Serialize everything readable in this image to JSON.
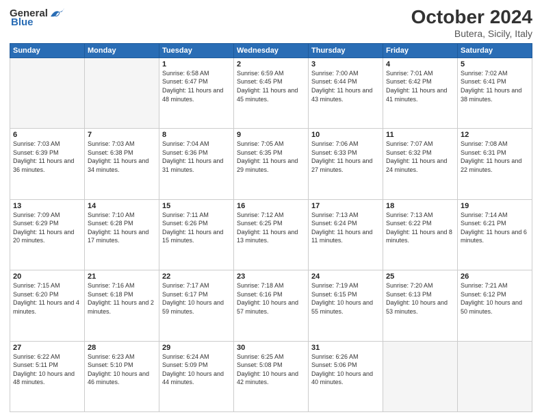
{
  "header": {
    "logo_general": "General",
    "logo_blue": "Blue",
    "month": "October 2024",
    "location": "Butera, Sicily, Italy"
  },
  "weekdays": [
    "Sunday",
    "Monday",
    "Tuesday",
    "Wednesday",
    "Thursday",
    "Friday",
    "Saturday"
  ],
  "weeks": [
    [
      {
        "day": "",
        "info": ""
      },
      {
        "day": "",
        "info": ""
      },
      {
        "day": "1",
        "info": "Sunrise: 6:58 AM\nSunset: 6:47 PM\nDaylight: 11 hours and 48 minutes."
      },
      {
        "day": "2",
        "info": "Sunrise: 6:59 AM\nSunset: 6:45 PM\nDaylight: 11 hours and 45 minutes."
      },
      {
        "day": "3",
        "info": "Sunrise: 7:00 AM\nSunset: 6:44 PM\nDaylight: 11 hours and 43 minutes."
      },
      {
        "day": "4",
        "info": "Sunrise: 7:01 AM\nSunset: 6:42 PM\nDaylight: 11 hours and 41 minutes."
      },
      {
        "day": "5",
        "info": "Sunrise: 7:02 AM\nSunset: 6:41 PM\nDaylight: 11 hours and 38 minutes."
      }
    ],
    [
      {
        "day": "6",
        "info": "Sunrise: 7:03 AM\nSunset: 6:39 PM\nDaylight: 11 hours and 36 minutes."
      },
      {
        "day": "7",
        "info": "Sunrise: 7:03 AM\nSunset: 6:38 PM\nDaylight: 11 hours and 34 minutes."
      },
      {
        "day": "8",
        "info": "Sunrise: 7:04 AM\nSunset: 6:36 PM\nDaylight: 11 hours and 31 minutes."
      },
      {
        "day": "9",
        "info": "Sunrise: 7:05 AM\nSunset: 6:35 PM\nDaylight: 11 hours and 29 minutes."
      },
      {
        "day": "10",
        "info": "Sunrise: 7:06 AM\nSunset: 6:33 PM\nDaylight: 11 hours and 27 minutes."
      },
      {
        "day": "11",
        "info": "Sunrise: 7:07 AM\nSunset: 6:32 PM\nDaylight: 11 hours and 24 minutes."
      },
      {
        "day": "12",
        "info": "Sunrise: 7:08 AM\nSunset: 6:31 PM\nDaylight: 11 hours and 22 minutes."
      }
    ],
    [
      {
        "day": "13",
        "info": "Sunrise: 7:09 AM\nSunset: 6:29 PM\nDaylight: 11 hours and 20 minutes."
      },
      {
        "day": "14",
        "info": "Sunrise: 7:10 AM\nSunset: 6:28 PM\nDaylight: 11 hours and 17 minutes."
      },
      {
        "day": "15",
        "info": "Sunrise: 7:11 AM\nSunset: 6:26 PM\nDaylight: 11 hours and 15 minutes."
      },
      {
        "day": "16",
        "info": "Sunrise: 7:12 AM\nSunset: 6:25 PM\nDaylight: 11 hours and 13 minutes."
      },
      {
        "day": "17",
        "info": "Sunrise: 7:13 AM\nSunset: 6:24 PM\nDaylight: 11 hours and 11 minutes."
      },
      {
        "day": "18",
        "info": "Sunrise: 7:13 AM\nSunset: 6:22 PM\nDaylight: 11 hours and 8 minutes."
      },
      {
        "day": "19",
        "info": "Sunrise: 7:14 AM\nSunset: 6:21 PM\nDaylight: 11 hours and 6 minutes."
      }
    ],
    [
      {
        "day": "20",
        "info": "Sunrise: 7:15 AM\nSunset: 6:20 PM\nDaylight: 11 hours and 4 minutes."
      },
      {
        "day": "21",
        "info": "Sunrise: 7:16 AM\nSunset: 6:18 PM\nDaylight: 11 hours and 2 minutes."
      },
      {
        "day": "22",
        "info": "Sunrise: 7:17 AM\nSunset: 6:17 PM\nDaylight: 10 hours and 59 minutes."
      },
      {
        "day": "23",
        "info": "Sunrise: 7:18 AM\nSunset: 6:16 PM\nDaylight: 10 hours and 57 minutes."
      },
      {
        "day": "24",
        "info": "Sunrise: 7:19 AM\nSunset: 6:15 PM\nDaylight: 10 hours and 55 minutes."
      },
      {
        "day": "25",
        "info": "Sunrise: 7:20 AM\nSunset: 6:13 PM\nDaylight: 10 hours and 53 minutes."
      },
      {
        "day": "26",
        "info": "Sunrise: 7:21 AM\nSunset: 6:12 PM\nDaylight: 10 hours and 50 minutes."
      }
    ],
    [
      {
        "day": "27",
        "info": "Sunrise: 6:22 AM\nSunset: 5:11 PM\nDaylight: 10 hours and 48 minutes."
      },
      {
        "day": "28",
        "info": "Sunrise: 6:23 AM\nSunset: 5:10 PM\nDaylight: 10 hours and 46 minutes."
      },
      {
        "day": "29",
        "info": "Sunrise: 6:24 AM\nSunset: 5:09 PM\nDaylight: 10 hours and 44 minutes."
      },
      {
        "day": "30",
        "info": "Sunrise: 6:25 AM\nSunset: 5:08 PM\nDaylight: 10 hours and 42 minutes."
      },
      {
        "day": "31",
        "info": "Sunrise: 6:26 AM\nSunset: 5:06 PM\nDaylight: 10 hours and 40 minutes."
      },
      {
        "day": "",
        "info": ""
      },
      {
        "day": "",
        "info": ""
      }
    ]
  ]
}
